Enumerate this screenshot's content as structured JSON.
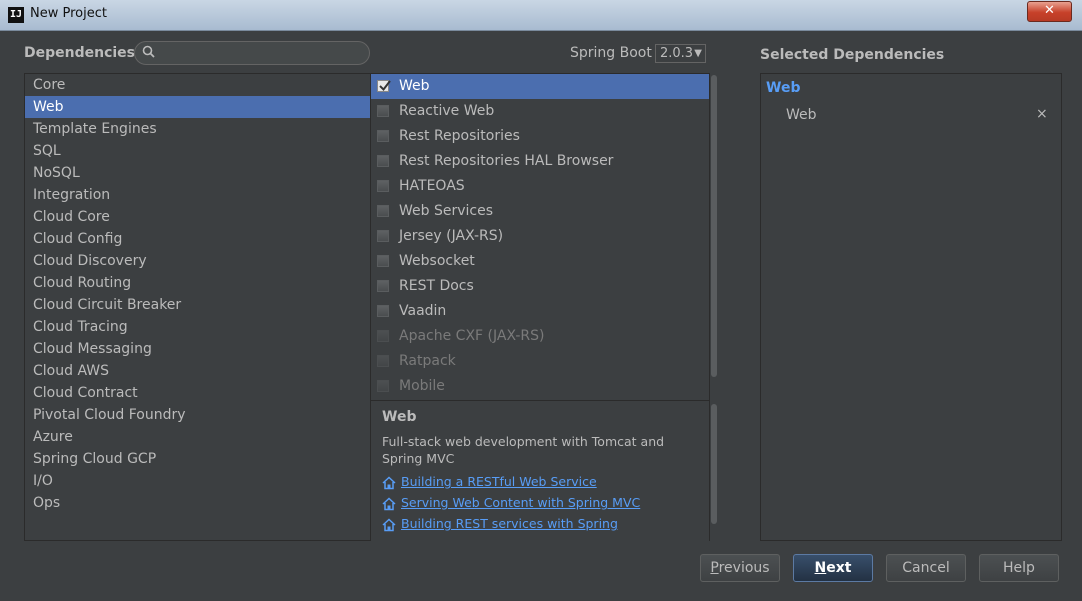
{
  "window": {
    "title": "New Project",
    "close_label": "✕"
  },
  "header": {
    "dependencies_label": "Dependencies",
    "search_placeholder": "",
    "search_value": "",
    "spring_boot_label": "Spring Boot",
    "spring_boot_version": "2.0.3",
    "selected_dependencies_label": "Selected Dependencies"
  },
  "categories": {
    "selected": "Web",
    "items": [
      "Core",
      "Web",
      "Template Engines",
      "SQL",
      "NoSQL",
      "Integration",
      "Cloud Core",
      "Cloud Config",
      "Cloud Discovery",
      "Cloud Routing",
      "Cloud Circuit Breaker",
      "Cloud Tracing",
      "Cloud Messaging",
      "Cloud AWS",
      "Cloud Contract",
      "Pivotal Cloud Foundry",
      "Azure",
      "Spring Cloud GCP",
      "I/O",
      "Ops"
    ]
  },
  "dependencies": [
    {
      "label": "Web",
      "checked": true,
      "selected": true,
      "enabled": true
    },
    {
      "label": "Reactive Web",
      "checked": false,
      "selected": false,
      "enabled": true
    },
    {
      "label": "Rest Repositories",
      "checked": false,
      "selected": false,
      "enabled": true
    },
    {
      "label": "Rest Repositories HAL Browser",
      "checked": false,
      "selected": false,
      "enabled": true
    },
    {
      "label": "HATEOAS",
      "checked": false,
      "selected": false,
      "enabled": true
    },
    {
      "label": "Web Services",
      "checked": false,
      "selected": false,
      "enabled": true
    },
    {
      "label": "Jersey (JAX-RS)",
      "checked": false,
      "selected": false,
      "enabled": true
    },
    {
      "label": "Websocket",
      "checked": false,
      "selected": false,
      "enabled": true
    },
    {
      "label": "REST Docs",
      "checked": false,
      "selected": false,
      "enabled": true
    },
    {
      "label": "Vaadin",
      "checked": false,
      "selected": false,
      "enabled": true
    },
    {
      "label": "Apache CXF (JAX-RS)",
      "checked": false,
      "selected": false,
      "enabled": false
    },
    {
      "label": "Ratpack",
      "checked": false,
      "selected": false,
      "enabled": false
    },
    {
      "label": "Mobile",
      "checked": false,
      "selected": false,
      "enabled": false
    }
  ],
  "description": {
    "title": "Web",
    "text": "Full-stack web development with Tomcat and Spring MVC",
    "guides": [
      {
        "label": "Building a RESTful Web Service",
        "icon": "home-icon"
      },
      {
        "label": "Serving Web Content with Spring MVC",
        "icon": "home-icon"
      },
      {
        "label": "Building REST services with Spring",
        "icon": "home-icon"
      }
    ]
  },
  "selected_dependencies": {
    "group": "Web",
    "items": [
      {
        "label": "Web",
        "remove_icon": "×"
      }
    ]
  },
  "buttons": {
    "previous": {
      "mnemonic": "P",
      "rest": "revious"
    },
    "next": {
      "mnemonic": "N",
      "rest": "ext"
    },
    "cancel": "Cancel",
    "help": "Help"
  },
  "colors": {
    "selection": "#4b6eaf",
    "link": "#589df6",
    "background": "#3c3f41"
  }
}
